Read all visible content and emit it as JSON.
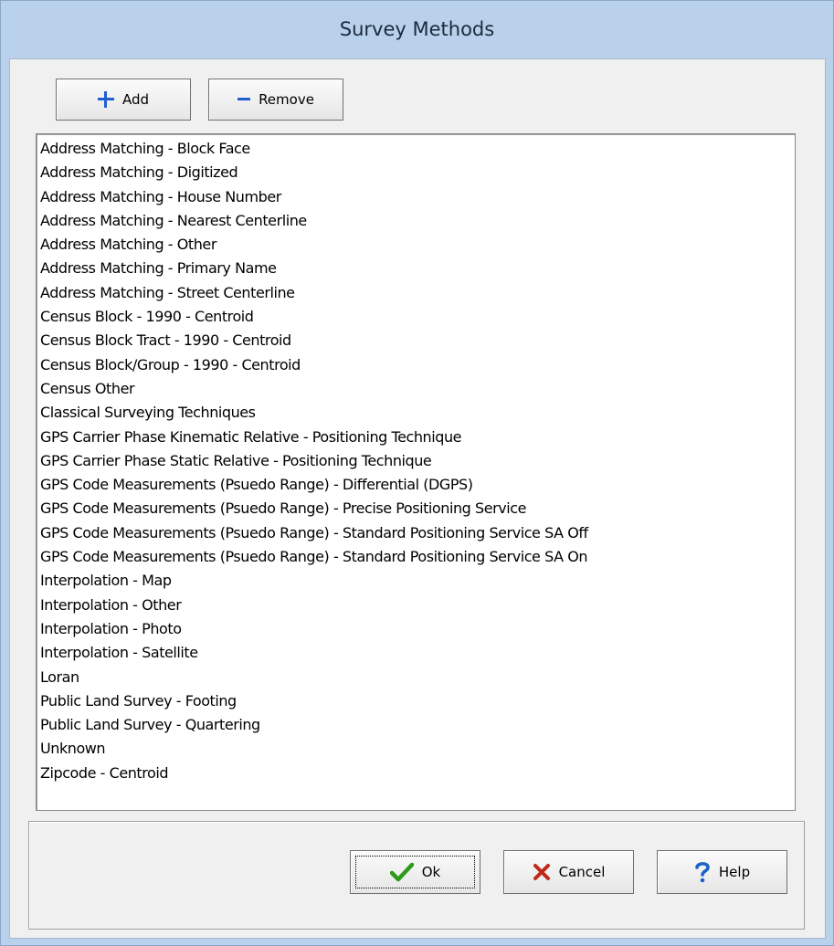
{
  "window": {
    "title": "Survey Methods"
  },
  "toolbar": {
    "add_label": "Add",
    "remove_label": "Remove",
    "add_icon": "plus-icon",
    "remove_icon": "minus-icon"
  },
  "list": {
    "items": [
      "Address Matching - Block Face",
      "Address Matching - Digitized",
      "Address Matching - House Number",
      "Address Matching - Nearest Centerline",
      "Address Matching - Other",
      "Address Matching - Primary Name",
      "Address Matching - Street Centerline",
      "Census Block - 1990 - Centroid",
      "Census Block Tract - 1990 - Centroid",
      "Census Block/Group - 1990 - Centroid",
      "Census Other",
      "Classical Surveying Techniques",
      "GPS Carrier Phase Kinematic Relative - Positioning Technique",
      "GPS Carrier Phase Static Relative - Positioning Technique",
      "GPS Code Measurements (Psuedo Range) - Differential (DGPS)",
      "GPS Code Measurements (Psuedo Range) - Precise Positioning Service",
      "GPS Code Measurements (Psuedo Range) - Standard Positioning Service SA Off",
      "GPS Code Measurements (Psuedo Range) - Standard Positioning Service SA On",
      "Interpolation - Map",
      "Interpolation - Other",
      "Interpolation - Photo",
      "Interpolation - Satellite",
      "Loran",
      "Public Land Survey - Footing",
      "Public Land Survey - Quartering",
      "Unknown",
      "Zipcode - Centroid"
    ]
  },
  "footer": {
    "ok_label": "Ok",
    "cancel_label": "Cancel",
    "help_label": "Help",
    "ok_icon": "checkmark-icon",
    "cancel_icon": "x-icon",
    "help_icon": "question-mark-icon"
  },
  "colors": {
    "titlebar": "#b9d1ea",
    "add_icon": "#1f5fd0",
    "ok_icon": "#2e9a1a",
    "cancel_icon": "#c0281c",
    "help_icon": "#1b63c6"
  }
}
